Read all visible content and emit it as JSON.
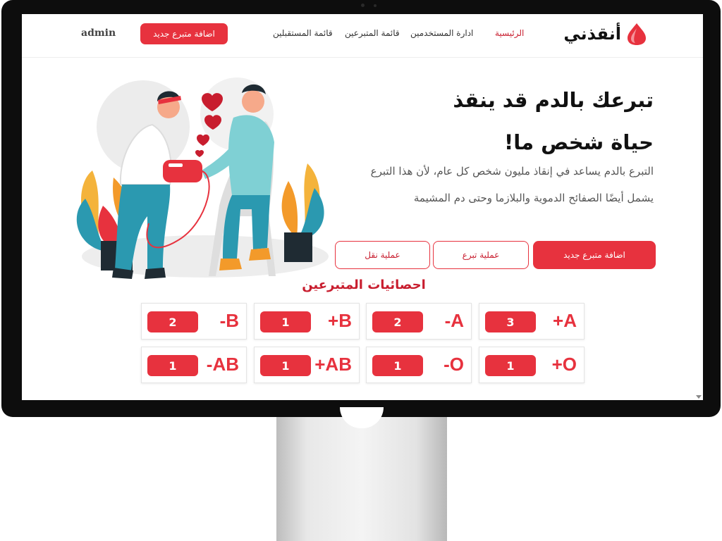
{
  "brand": {
    "name": "أنقذني"
  },
  "nav": {
    "items": [
      {
        "label": "الرئيسية",
        "active": true
      },
      {
        "label": "ادارة المستخدمين",
        "active": false
      },
      {
        "label": "قائمة المتبرعين",
        "active": false
      },
      {
        "label": "قائمة المستقبلين",
        "active": false
      }
    ],
    "add_donor_button": "اضافة متبرع جديد",
    "user": "admin"
  },
  "hero": {
    "title_line1": "تبرعك بالدم قد ينقذ",
    "title_line2": "حياة شخص ما!",
    "description": "التبرع بالدم يساعد في إنقاذ مليون شخص كل عام، لأن هذا التبرع يشمل أيضًا الصفائح الدموية والبلازما وحتى دم المشيمة",
    "buttons": {
      "add_donor": "اضافة متبرع جديد",
      "donation": "عملية تبرع",
      "transfer": "عملية نقل"
    }
  },
  "stats": {
    "title": "احصائيات المتبرعين",
    "blood_types": [
      {
        "type": "+A",
        "count": "3"
      },
      {
        "type": "-A",
        "count": "2"
      },
      {
        "type": "+B",
        "count": "1"
      },
      {
        "type": "-B",
        "count": "2"
      },
      {
        "type": "+O",
        "count": "1"
      },
      {
        "type": "-O",
        "count": "1"
      },
      {
        "type": "+AB",
        "count": "1"
      },
      {
        "type": "-AB",
        "count": "1"
      }
    ]
  },
  "colors": {
    "accent": "#e7323e",
    "accent_dark": "#c81d2e",
    "frame": "#0d0d0d"
  },
  "icons": {
    "logo": "blood-drop-icon"
  }
}
